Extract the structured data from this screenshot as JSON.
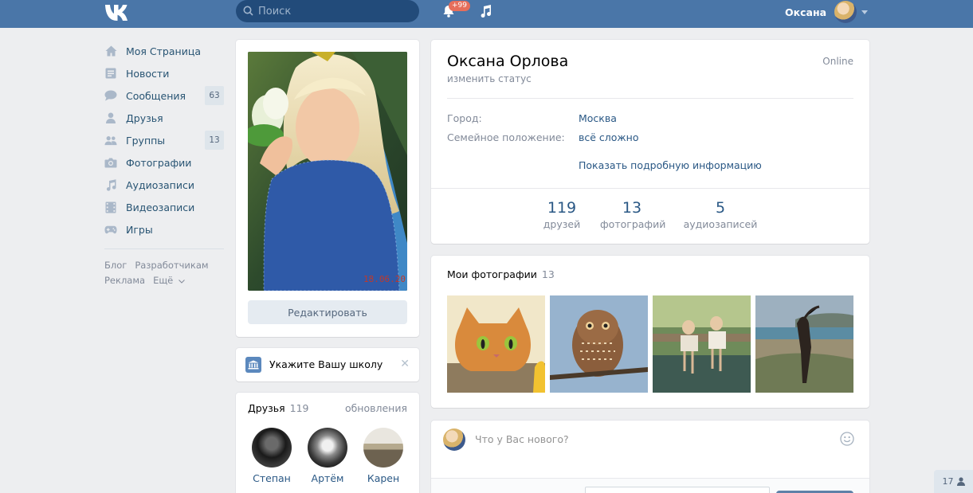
{
  "header": {
    "logo": "vk-logo",
    "search": {
      "placeholder": "Поиск"
    },
    "notifications_badge": "+99",
    "user_name": "Оксана"
  },
  "left_menu": {
    "items": [
      {
        "label": "Моя Страница",
        "icon": "home-icon"
      },
      {
        "label": "Новости",
        "icon": "news-icon"
      },
      {
        "label": "Сообщения",
        "icon": "messages-icon",
        "badge": "63"
      },
      {
        "label": "Друзья",
        "icon": "friends-icon"
      },
      {
        "label": "Группы",
        "icon": "groups-icon",
        "badge": "13"
      },
      {
        "label": "Фотографии",
        "icon": "camera-icon"
      },
      {
        "label": "Аудиозаписи",
        "icon": "music-icon"
      },
      {
        "label": "Видеозаписи",
        "icon": "video-icon"
      },
      {
        "label": "Игры",
        "icon": "gamepad-icon"
      }
    ],
    "footer_links": [
      "Блог",
      "Разработчикам",
      "Реклама",
      "Ещё"
    ]
  },
  "profile_photo": {
    "photo_date": "18.06.20",
    "edit_label": "Редактировать"
  },
  "school": {
    "text": "Укажите Вашу школу"
  },
  "friends": {
    "title": "Друзья",
    "count": "119",
    "updates_label": "обновления",
    "list": [
      {
        "name": "Степан"
      },
      {
        "name": "Артём"
      },
      {
        "name": "Карен"
      }
    ]
  },
  "profile": {
    "name": "Оксана Орлова",
    "status_link": "изменить статус",
    "online": "Online",
    "city_label": "Город:",
    "city_value": "Москва",
    "family_label": "Семейное положение:",
    "family_value": "всё сложно",
    "more_info": "Показать подробную информацию",
    "counters": [
      {
        "num": "119",
        "cap": "друзей"
      },
      {
        "num": "13",
        "cap": "фотографий"
      },
      {
        "num": "5",
        "cap": "аудиозаписей"
      }
    ]
  },
  "photos": {
    "title": "Мои фотографии",
    "count": "13"
  },
  "post": {
    "placeholder": "Что у Вас нового?"
  },
  "chat": {
    "count": "17"
  },
  "colors": {
    "header": "#4a76a8",
    "link": "#2a5885",
    "background": "#edeef0"
  }
}
